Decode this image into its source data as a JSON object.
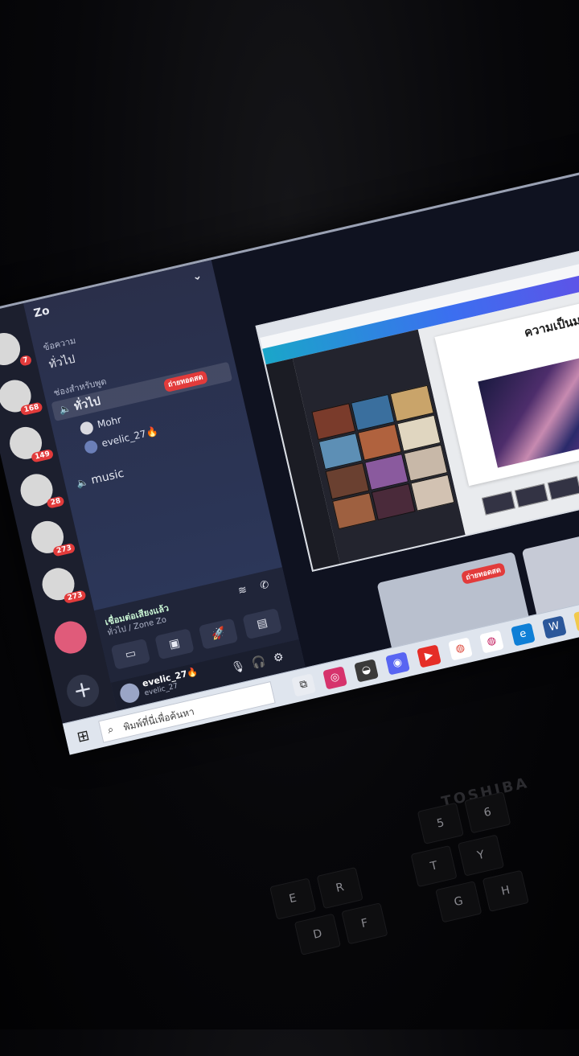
{
  "discord": {
    "server_name": "Zo",
    "category_text": "ข้อความ",
    "text_channel": "ทั่วไป",
    "category_voice": "ช่องสำหรับพูด",
    "voice_channel_general": "ทั่วไป",
    "live_badge": "ถ่ายทอดสด",
    "voice_users": [
      "Mohr",
      "evelic_27🔥"
    ],
    "voice_channel_music": "music",
    "guild_badges": [
      "7",
      "168",
      "149",
      "28",
      "273",
      "273"
    ],
    "voice_status": "เชื่อมต่อเสียงแล้ว",
    "voice_location": "ทั่วไป / Zone Zo",
    "user_name": "evelic_27🔥",
    "user_tag": "evelic_27"
  },
  "share": {
    "slide_title": "ความเป็นมาของ",
    "tile_live_badge": "ถ่ายทอดสด"
  },
  "taskbar": {
    "search_placeholder": "พิมพ์ที่นี่เพื่อค้นหา"
  },
  "laptop": {
    "brand": "TOSHIBA",
    "keys": [
      "5",
      "6",
      "Y",
      "T",
      "G",
      "H",
      "E",
      "R",
      "D",
      "F"
    ]
  },
  "colors": {
    "live_red": "#e23b3b",
    "discord_panel": "#2a2f4a",
    "canva_gradient_start": "#1aa6c9",
    "canva_gradient_end": "#6b48e4"
  }
}
